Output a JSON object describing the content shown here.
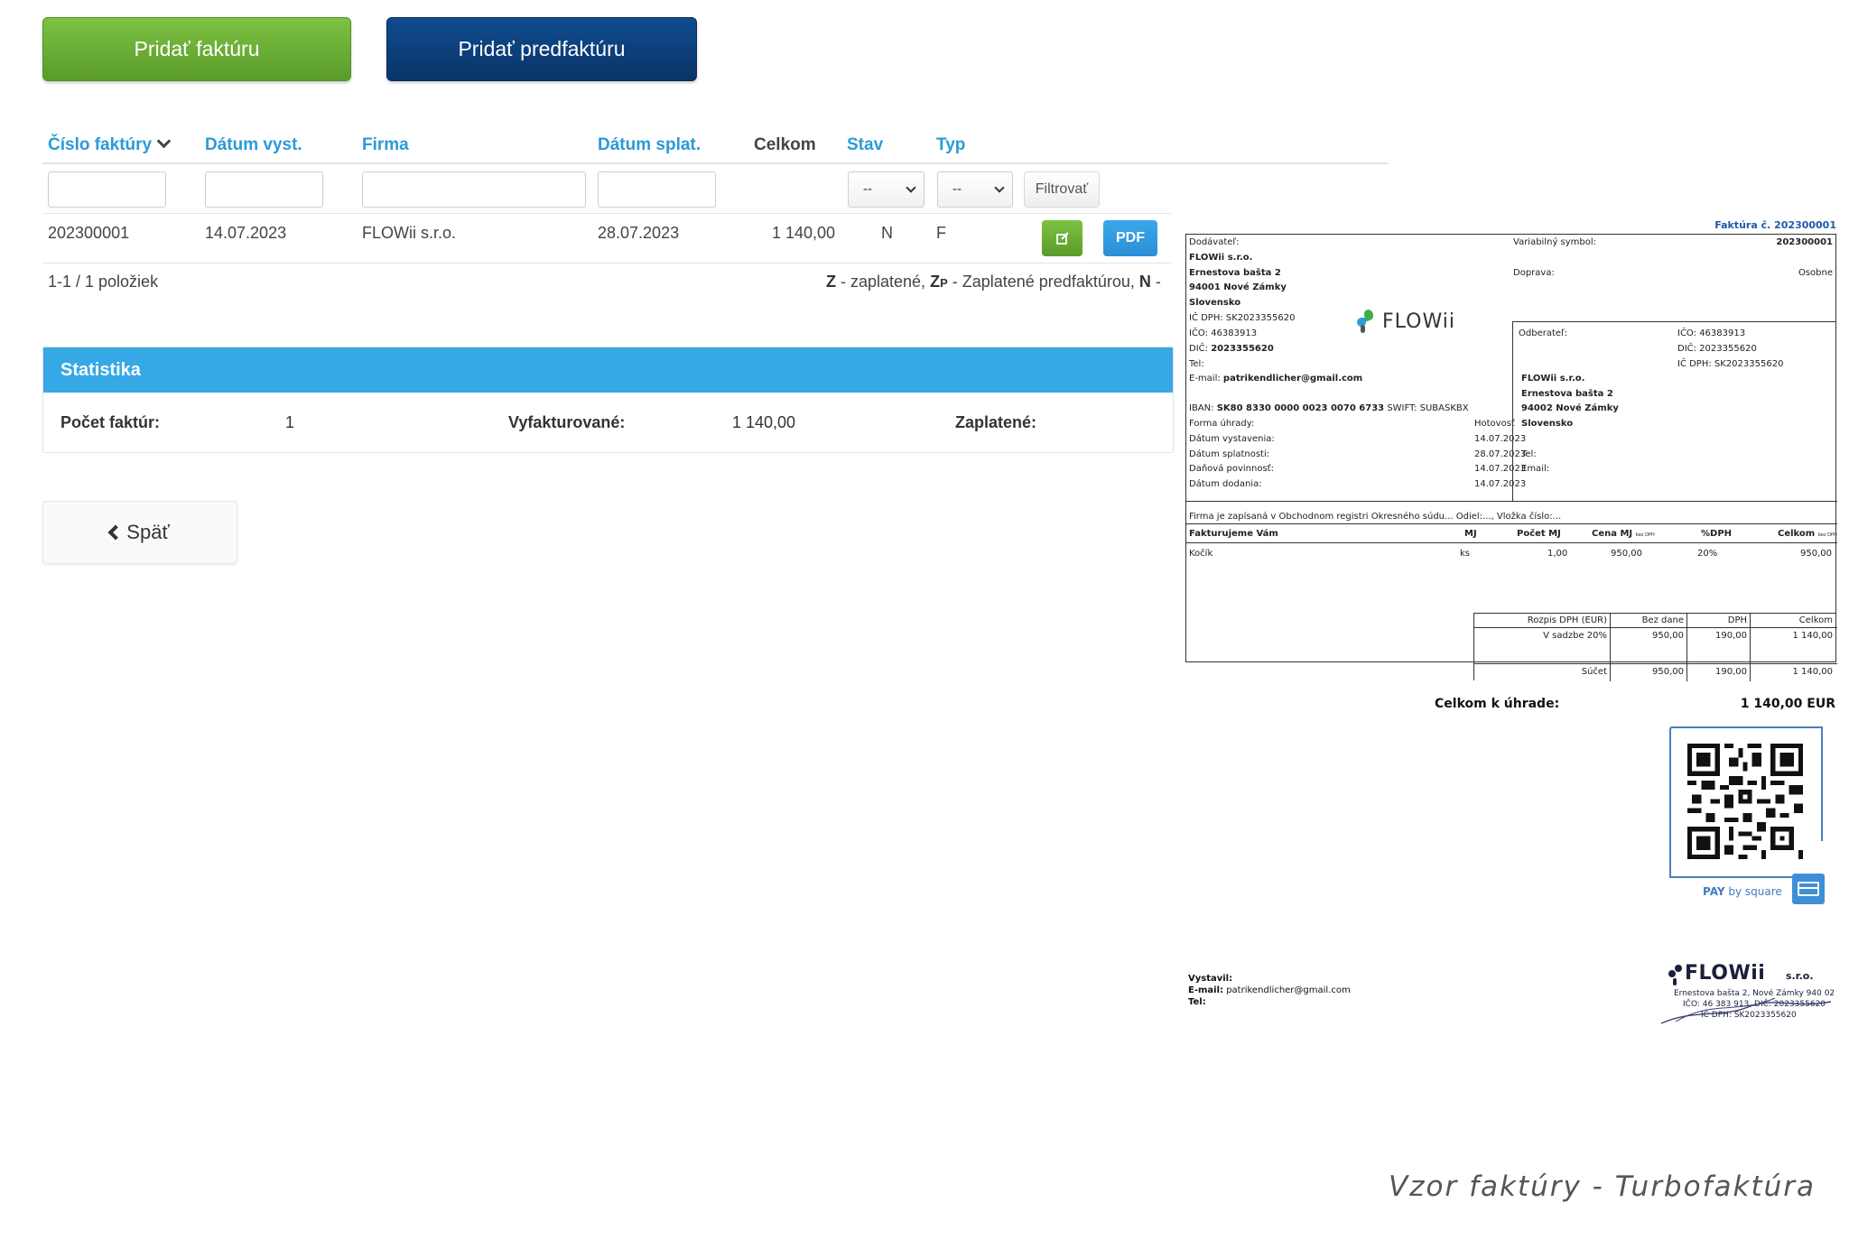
{
  "buttons": {
    "add_invoice": "Pridať faktúru",
    "add_proforma": "Pridať predfaktúru",
    "filter": "Filtrovať",
    "pdf": "PDF",
    "back": "Späť"
  },
  "table": {
    "columns": [
      "Číslo faktúry",
      "Dátum vyst.",
      "Firma",
      "Dátum splat.",
      "Celkom",
      "Stav",
      "Typ"
    ],
    "filter_select_value": "--",
    "rows": [
      {
        "number": "202300001",
        "issued": "14.07.2023",
        "company": "FLOWii s.r.o.",
        "due": "28.07.2023",
        "total": "1 140,00",
        "status": "N",
        "type": "F"
      }
    ],
    "pager": "1-1 / 1 položiek",
    "legend": {
      "z": "Z",
      "z_text": " - zaplatené, ",
      "zp_main": "Z",
      "zp_sub": "P",
      "zp_text": " - Zaplatené predfaktúrou, ",
      "n": "N",
      "n_text": " -"
    }
  },
  "stats": {
    "title": "Statistika",
    "count_label": "Počet faktúr:",
    "count_value": "1",
    "invoiced_label": "Vyfakturované:",
    "invoiced_value": "1 140,00",
    "paid_label": "Zaplatené:"
  },
  "invoice": {
    "title": "Faktúra č. 202300001",
    "supplier_label": "Dodávateľ:",
    "supplier_name": "FLOWii s.r.o.",
    "supplier_street": "Ernestova bašta 2",
    "supplier_city": "94001 Nové Zámky",
    "supplier_country": "Slovensko",
    "supplier_icdph": "IČ DPH: SK2023355620",
    "supplier_ico_label": "IČO:",
    "supplier_ico": "46383913",
    "supplier_dic_label": "DIČ:",
    "supplier_dic": "2023355620",
    "supplier_tel": "Tel:",
    "supplier_email_label": "E-mail:",
    "supplier_email": "patrikendlicher@gmail.com",
    "iban_label": "IBAN:",
    "iban": "SK80 8330 0000 0023 0070 6733",
    "swift": "SWIFT: SUBASKBX",
    "logo_text": "FLOWii",
    "var_symbol_label": "Variabilný symbol:",
    "var_symbol": "202300001",
    "transport_label": "Doprava:",
    "transport": "Osobne",
    "customer_label": "Odberateľ:",
    "customer_ico": "IČO: 46383913",
    "customer_dic": "DIČ: 2023355620",
    "customer_icdph": "IČ DPH: SK2023355620",
    "customer_name": "FLOWii s.r.o.",
    "customer_street": "Ernestova bašta 2",
    "customer_city": "94002 Nové Zámky",
    "customer_country": "Slovensko",
    "customer_tel": "Tel:",
    "customer_email": "Email:",
    "payment_label": "Forma úhrady:",
    "payment": "Hotovosť",
    "dates": [
      {
        "label": "Dátum vystavenia:",
        "value": "14.07.2023"
      },
      {
        "label": "Dátum splatnosti:",
        "value": "28.07.2023"
      },
      {
        "label": "Daňová povinnosť:",
        "value": "14.07.2023"
      },
      {
        "label": "Dátum dodania:",
        "value": "14.07.2023"
      }
    ],
    "register_note": "Firma je zapísaná v Obchodnom registri Okresného súdu... Odiel:..., Vložka číslo:...",
    "items_header": {
      "desc": "Fakturujeme Vám",
      "unit": "MJ",
      "qty": "Počet MJ",
      "price": "Cena MJ",
      "price_note": "bez DPH",
      "vat": "%DPH",
      "total": "Celkom",
      "total_note": "bez DPH"
    },
    "items": [
      {
        "desc": "Kočík",
        "unit": "ks",
        "qty": "1,00",
        "price": "950,00",
        "vat": "20%",
        "total": "950,00"
      }
    ],
    "vat_table": {
      "headers": [
        "Rozpis DPH (EUR)",
        "Bez dane",
        "DPH",
        "Celkom"
      ],
      "row": [
        "V sadzbe 20%",
        "950,00",
        "190,00",
        "1 140,00"
      ],
      "sum": [
        "Súčet",
        "950,00",
        "190,00",
        "1 140,00"
      ]
    },
    "total_due_label": "Celkom k úhrade:",
    "total_due": "1 140,00 EUR",
    "pay_by_square_a": "PAY",
    "pay_by_square_b": " by square",
    "issuer_label": "Vystavil:",
    "issuer_email_label": "E-mail:",
    "issuer_email": "patrikendlicher@gmail.com",
    "issuer_tel": "Tel:",
    "stamp": {
      "name": "FLOWii",
      "sro": "s.r.o.",
      "line1": "Ernestova bašta 2, Nové Zámky 940 02",
      "line2": "IČO: 46 383 913, DIČ: 2023355620",
      "line3": "IČ DPH: SK2023355620"
    }
  },
  "caption": "Vzor faktúry - Turbofaktúra"
}
